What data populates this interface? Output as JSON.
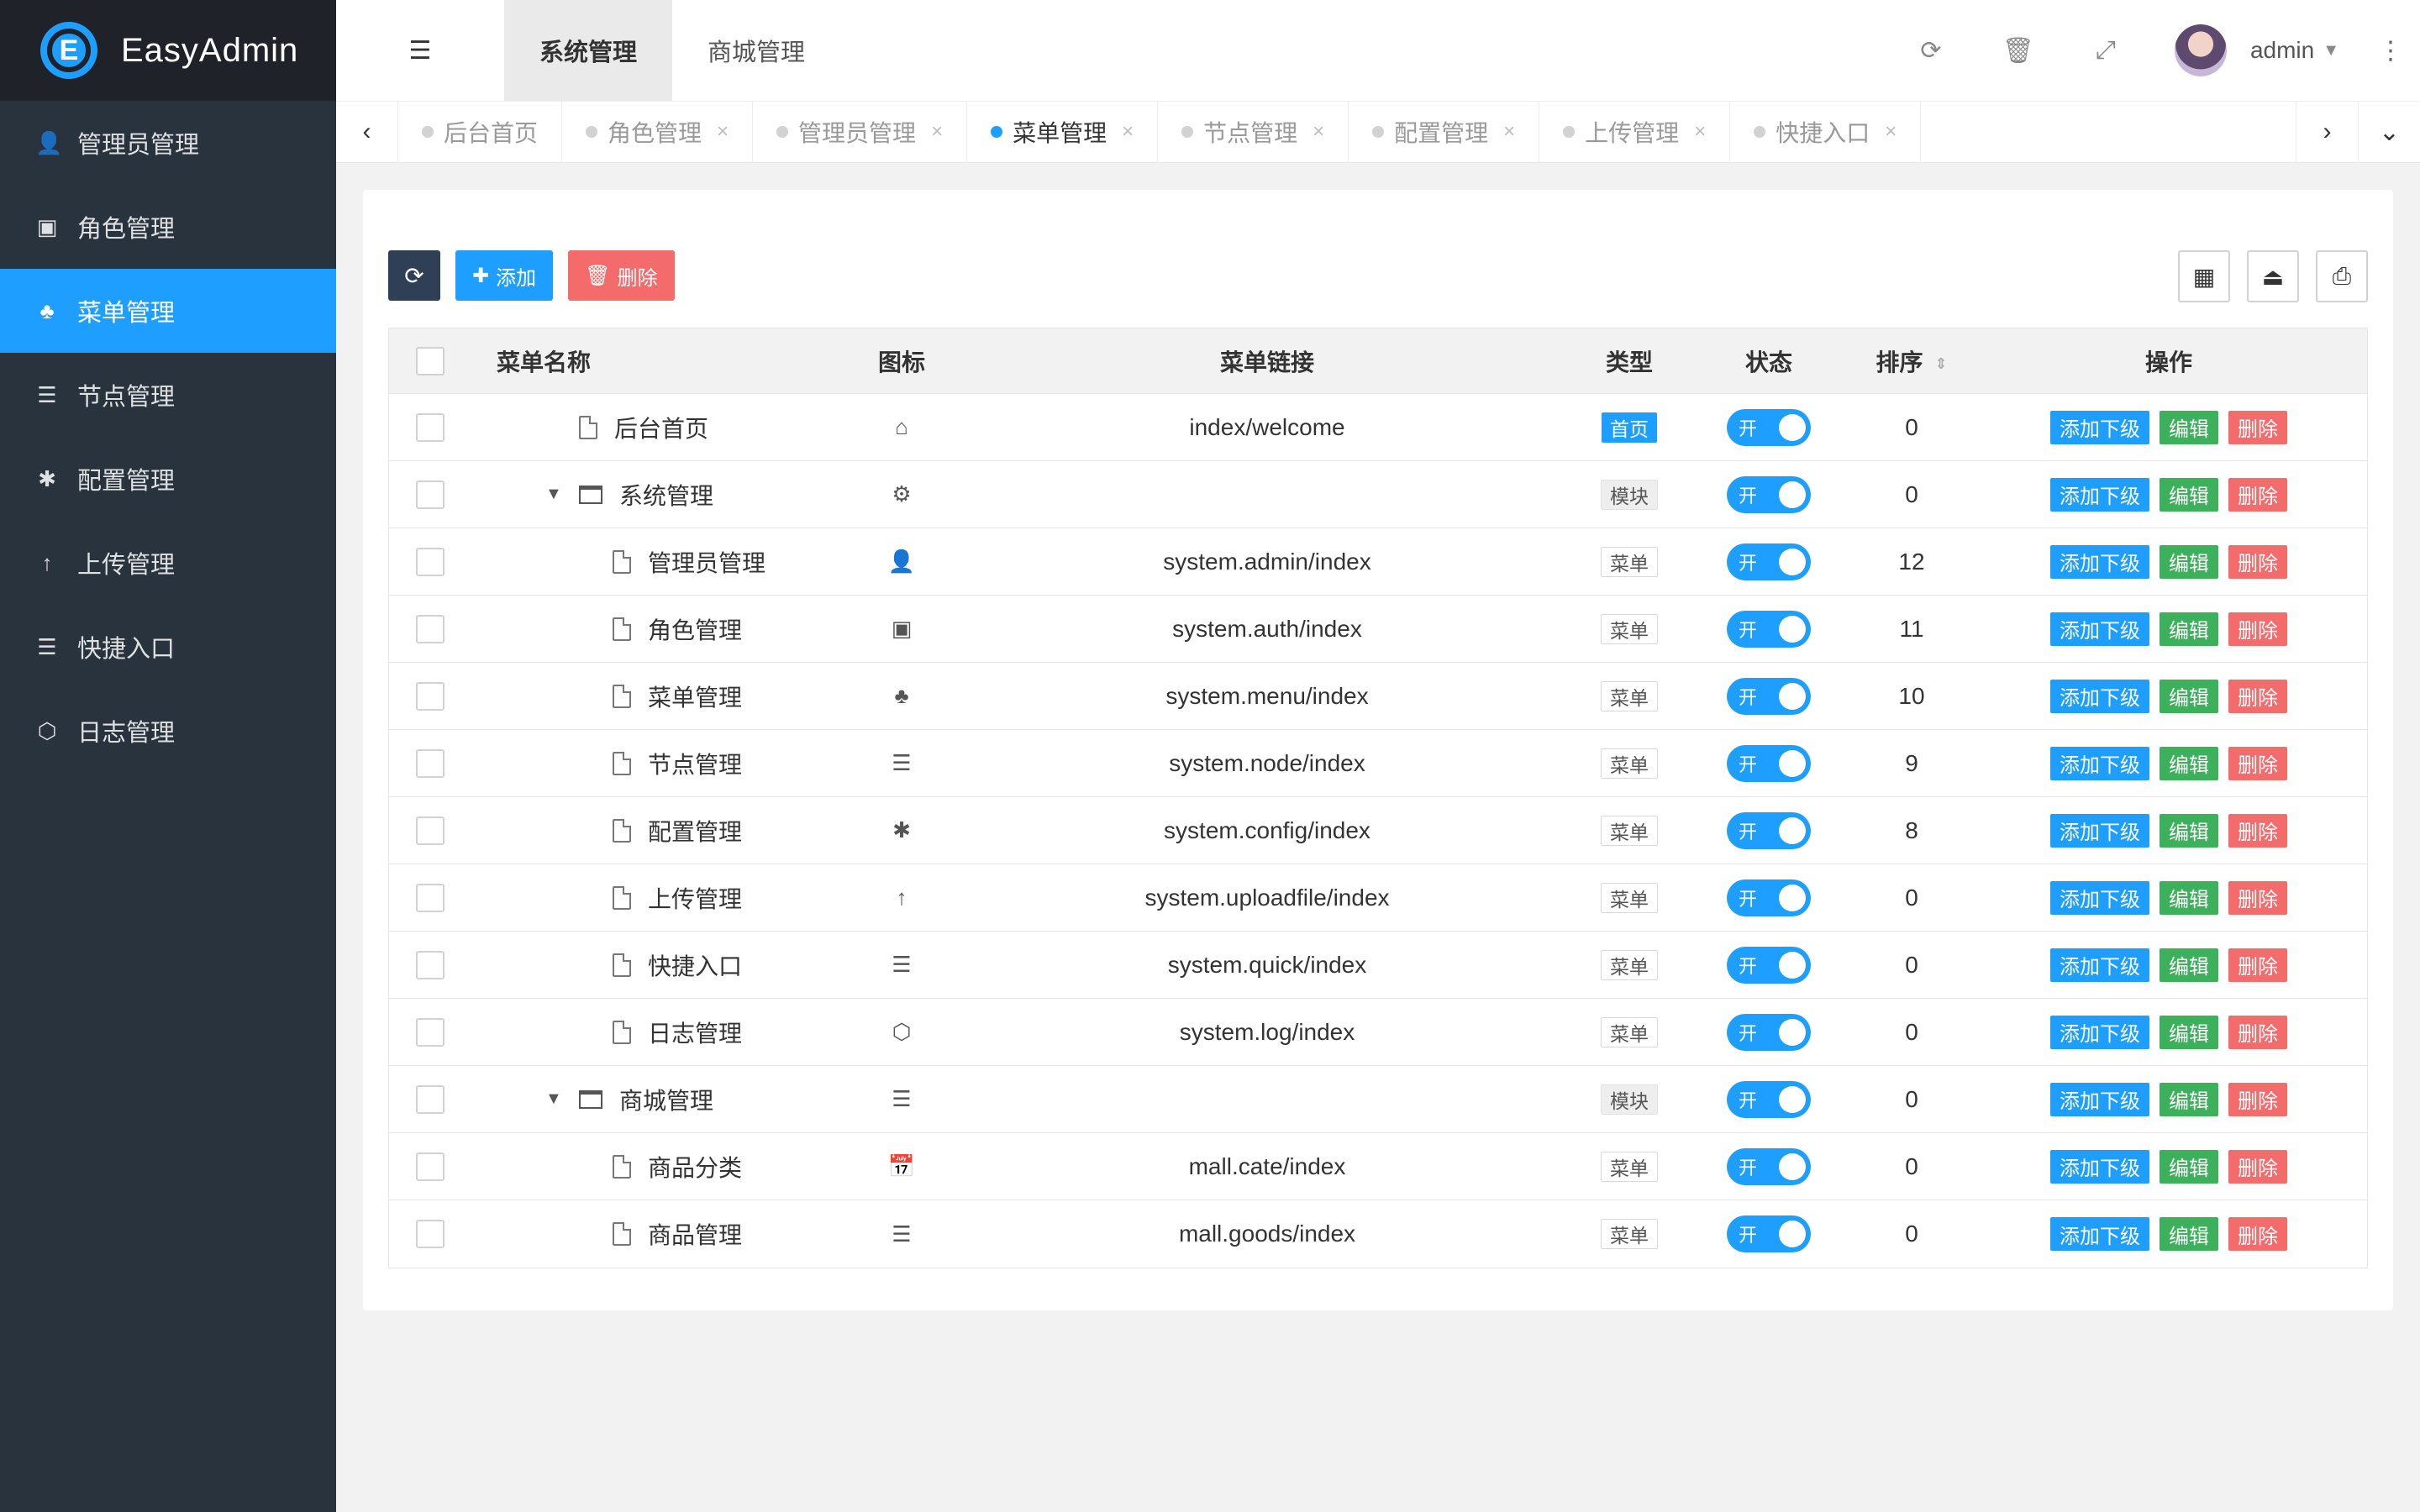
{
  "app": {
    "logo_letter": "E",
    "name": "EasyAdmin"
  },
  "sidebar": {
    "items": [
      {
        "label": "管理员管理",
        "icon": "user-icon",
        "glyph": "👤"
      },
      {
        "label": "角色管理",
        "icon": "id-card-icon",
        "glyph": "▣"
      },
      {
        "label": "菜单管理",
        "icon": "tree-icon",
        "glyph": "♣",
        "active": true
      },
      {
        "label": "节点管理",
        "icon": "list-icon",
        "glyph": "☰"
      },
      {
        "label": "配置管理",
        "icon": "asterisk-icon",
        "glyph": "✱"
      },
      {
        "label": "上传管理",
        "icon": "arrow-up-icon",
        "glyph": "↑"
      },
      {
        "label": "快捷入口",
        "icon": "list-icon",
        "glyph": "☰"
      },
      {
        "label": "日志管理",
        "icon": "hexagon-icon",
        "glyph": "⬡"
      }
    ]
  },
  "header": {
    "top_tabs": [
      "系统管理",
      "商城管理"
    ],
    "active_top_tab": 0,
    "username": "admin"
  },
  "page_tabs": {
    "items": [
      {
        "label": "后台首页",
        "closable": false
      },
      {
        "label": "角色管理",
        "closable": true
      },
      {
        "label": "管理员管理",
        "closable": true
      },
      {
        "label": "菜单管理",
        "closable": true,
        "active": true
      },
      {
        "label": "节点管理",
        "closable": true
      },
      {
        "label": "配置管理",
        "closable": true
      },
      {
        "label": "上传管理",
        "closable": true
      },
      {
        "label": "快捷入口",
        "closable": true
      }
    ],
    "close_glyph": "×"
  },
  "toolbar": {
    "add_label": "添加",
    "delete_label": "删除"
  },
  "table": {
    "columns": {
      "name": "菜单名称",
      "icon": "图标",
      "href": "菜单链接",
      "type": "类型",
      "status": "状态",
      "sort": "排序",
      "ops": "操作"
    },
    "switch_on_label": "开",
    "ops": {
      "add_child": "添加下级",
      "edit": "编辑",
      "delete": "删除"
    },
    "rows": [
      {
        "title": "后台首页",
        "level": 0,
        "kind": "file",
        "icon": "home-icon",
        "glyph": "⌂",
        "href": "index/welcome",
        "type": "首页",
        "type_kind": "home",
        "sort": "0"
      },
      {
        "title": "系统管理",
        "level": 0,
        "kind": "folder",
        "icon": "gear-icon",
        "glyph": "⚙",
        "href": "",
        "type": "模块",
        "type_kind": "module",
        "sort": "0"
      },
      {
        "title": "管理员管理",
        "level": 1,
        "kind": "file",
        "icon": "user-icon",
        "glyph": "👤",
        "href": "system.admin/index",
        "type": "菜单",
        "type_kind": "menu",
        "sort": "12"
      },
      {
        "title": "角色管理",
        "level": 1,
        "kind": "file",
        "icon": "id-card-icon",
        "glyph": "▣",
        "href": "system.auth/index",
        "type": "菜单",
        "type_kind": "menu",
        "sort": "11"
      },
      {
        "title": "菜单管理",
        "level": 1,
        "kind": "file",
        "icon": "tree-icon",
        "glyph": "♣",
        "href": "system.menu/index",
        "type": "菜单",
        "type_kind": "menu",
        "sort": "10"
      },
      {
        "title": "节点管理",
        "level": 1,
        "kind": "file",
        "icon": "list-icon",
        "glyph": "☰",
        "href": "system.node/index",
        "type": "菜单",
        "type_kind": "menu",
        "sort": "9"
      },
      {
        "title": "配置管理",
        "level": 1,
        "kind": "file",
        "icon": "asterisk-icon",
        "glyph": "✱",
        "href": "system.config/index",
        "type": "菜单",
        "type_kind": "menu",
        "sort": "8"
      },
      {
        "title": "上传管理",
        "level": 1,
        "kind": "file",
        "icon": "arrow-up-icon",
        "glyph": "↑",
        "href": "system.uploadfile/index",
        "type": "菜单",
        "type_kind": "menu",
        "sort": "0"
      },
      {
        "title": "快捷入口",
        "level": 1,
        "kind": "file",
        "icon": "list-icon",
        "glyph": "☰",
        "href": "system.quick/index",
        "type": "菜单",
        "type_kind": "menu",
        "sort": "0"
      },
      {
        "title": "日志管理",
        "level": 1,
        "kind": "file",
        "icon": "hexagon-icon",
        "glyph": "⬡",
        "href": "system.log/index",
        "type": "菜单",
        "type_kind": "menu",
        "sort": "0"
      },
      {
        "title": "商城管理",
        "level": 0,
        "kind": "folder",
        "icon": "list-icon",
        "glyph": "☰",
        "href": "",
        "type": "模块",
        "type_kind": "module",
        "sort": "0"
      },
      {
        "title": "商品分类",
        "level": 1,
        "kind": "file",
        "icon": "calendar-check-icon",
        "glyph": "📅",
        "href": "mall.cate/index",
        "type": "菜单",
        "type_kind": "menu",
        "sort": "0"
      },
      {
        "title": "商品管理",
        "level": 1,
        "kind": "file",
        "icon": "list-icon",
        "glyph": "☰",
        "href": "mall.goods/index",
        "type": "菜单",
        "type_kind": "menu",
        "sort": "0"
      }
    ]
  }
}
